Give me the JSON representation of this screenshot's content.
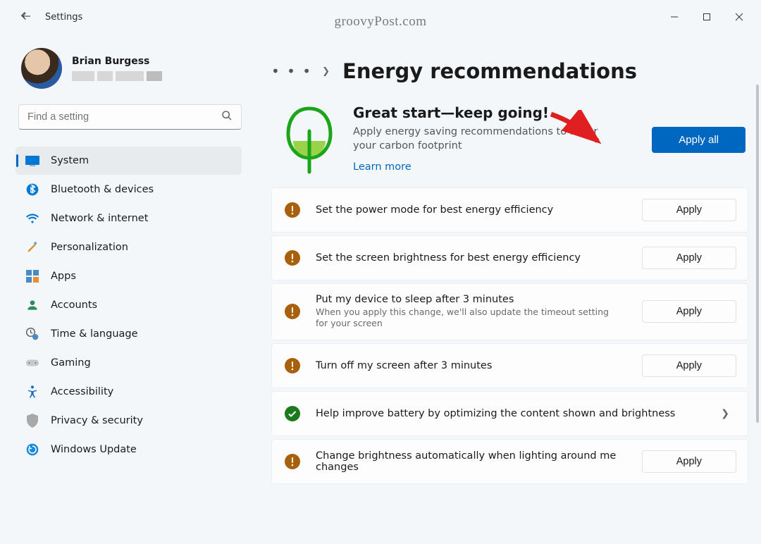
{
  "window": {
    "app_title": "Settings",
    "watermark": "groovyPost.com"
  },
  "profile": {
    "name": "Brian Burgess"
  },
  "search": {
    "placeholder": "Find a setting"
  },
  "sidebar": {
    "items": [
      {
        "label": "System",
        "icon": "system"
      },
      {
        "label": "Bluetooth & devices",
        "icon": "bluetooth"
      },
      {
        "label": "Network & internet",
        "icon": "wifi"
      },
      {
        "label": "Personalization",
        "icon": "brush"
      },
      {
        "label": "Apps",
        "icon": "apps"
      },
      {
        "label": "Accounts",
        "icon": "person"
      },
      {
        "label": "Time & language",
        "icon": "clock"
      },
      {
        "label": "Gaming",
        "icon": "gaming"
      },
      {
        "label": "Accessibility",
        "icon": "accessibility"
      },
      {
        "label": "Privacy & security",
        "icon": "shield"
      },
      {
        "label": "Windows Update",
        "icon": "update"
      }
    ],
    "active_index": 0
  },
  "page": {
    "breadcrumb_dots": "• • •",
    "title": "Energy recommendations",
    "hero_title": "Great start—keep going!",
    "hero_sub": "Apply energy saving recommendations to lower your carbon footprint",
    "learn_more": "Learn more",
    "apply_all": "Apply all"
  },
  "recommendations": [
    {
      "status": "warn",
      "label": "Set the power mode for best energy efficiency",
      "sub": "",
      "action": "Apply"
    },
    {
      "status": "warn",
      "label": "Set the screen brightness for best energy efficiency",
      "sub": "",
      "action": "Apply"
    },
    {
      "status": "warn",
      "label": "Put my device to sleep after 3 minutes",
      "sub": "When you apply this change, we'll also update the timeout setting for your screen",
      "action": "Apply"
    },
    {
      "status": "warn",
      "label": "Turn off my screen after 3 minutes",
      "sub": "",
      "action": "Apply"
    },
    {
      "status": "ok",
      "label": "Help improve battery by optimizing the content shown and brightness",
      "sub": "",
      "action": "chevron"
    },
    {
      "status": "warn",
      "label": "Change brightness automatically when lighting around me changes",
      "sub": "",
      "action": "Apply"
    }
  ]
}
